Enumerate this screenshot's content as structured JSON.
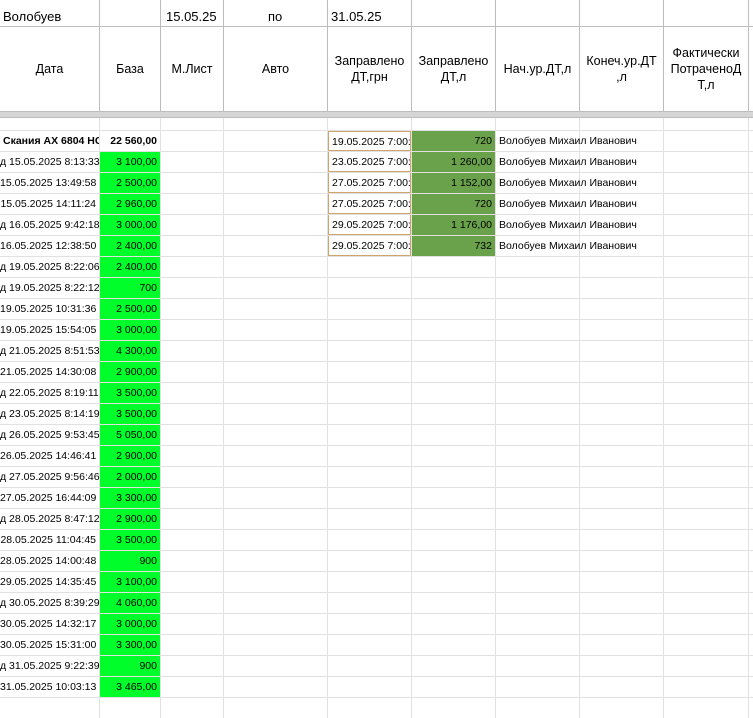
{
  "top": {
    "name": "Волобуев",
    "date_from": "15.05.25",
    "to_label": "по",
    "date_to": "31.05.25"
  },
  "headers": {
    "date": "Дата",
    "base": "База",
    "m_list": "М.Лист",
    "auto": "Авто",
    "fueled_uah": "Заправлено ДТ,грн",
    "fueled_l": "Заправлено ДТ,л",
    "start_level": "Нач.ур.ДТ,л",
    "end_level": "Конеч.ур.ДТ ,л",
    "actual_used": "Фактически ПотраченоД Т,л"
  },
  "summary": {
    "vehicle": "Скания АХ 6804 НС",
    "total": "22 560,00"
  },
  "base_rows": [
    {
      "date": "д 15.05.2025 8:13:33",
      "amount": "3 100,00"
    },
    {
      "date": "15.05.2025 13:49:58",
      "amount": "2 500,00"
    },
    {
      "date": "15.05.2025 14:11:24",
      "amount": "2 960,00"
    },
    {
      "date": "д 16.05.2025 9:42:18",
      "amount": "3 000,00"
    },
    {
      "date": "16.05.2025 12:38:50",
      "amount": "2 400,00"
    },
    {
      "date": "д 19.05.2025 8:22:06",
      "amount": "2 400,00"
    },
    {
      "date": "д 19.05.2025 8:22:12",
      "amount": "700"
    },
    {
      "date": "19.05.2025 10:31:36",
      "amount": "2 500,00"
    },
    {
      "date": "19.05.2025 15:54:05",
      "amount": "3 000,00"
    },
    {
      "date": "д 21.05.2025 8:51:53",
      "amount": "4 300,00"
    },
    {
      "date": "21.05.2025 14:30:08",
      "amount": "2 900,00"
    },
    {
      "date": "д 22.05.2025 8:19:11",
      "amount": "3 500,00"
    },
    {
      "date": "д 23.05.2025 8:14:19",
      "amount": "3 500,00"
    },
    {
      "date": "д 26.05.2025 9:53:45",
      "amount": "5 050,00"
    },
    {
      "date": "26.05.2025 14:46:41",
      "amount": "2 900,00"
    },
    {
      "date": "д 27.05.2025 9:56:46",
      "amount": "2 000,00"
    },
    {
      "date": "27.05.2025 16:44:09",
      "amount": "3 300,00"
    },
    {
      "date": "д 28.05.2025 8:47:12",
      "amount": "2 900,00"
    },
    {
      "date": "28.05.2025 11:04:45",
      "amount": "3 500,00"
    },
    {
      "date": "28.05.2025 14:00:48",
      "amount": "900"
    },
    {
      "date": "29.05.2025 14:35:45",
      "amount": "3 100,00"
    },
    {
      "date": "д 30.05.2025 8:39:29",
      "amount": "4 060,00"
    },
    {
      "date": "30.05.2025 14:32:17",
      "amount": "3 000,00"
    },
    {
      "date": "30.05.2025 15:31:00",
      "amount": "3 300,00"
    },
    {
      "date": "д 31.05.2025 9:22:39",
      "amount": "900"
    },
    {
      "date": "31.05.2025 10:03:13",
      "amount": "3 465,00"
    }
  ],
  "fuel_rows": [
    {
      "date": "19.05.2025 7:00:00",
      "liters": "720",
      "driver": "Волобуев Михаил Иванович"
    },
    {
      "date": "23.05.2025 7:00:00",
      "liters": "1 260,00",
      "driver": "Волобуев Михаил Иванович"
    },
    {
      "date": "27.05.2025 7:00:00",
      "liters": "1 152,00",
      "driver": "Волобуев Михаил Иванович"
    },
    {
      "date": "27.05.2025 7:00:00",
      "liters": "720",
      "driver": "Волобуев Михаил Иванович"
    },
    {
      "date": "29.05.2025 7:00:00",
      "liters": "1 176,00",
      "driver": "Волобуев Михаил Иванович"
    },
    {
      "date": "29.05.2025 7:00:00",
      "liters": "732",
      "driver": "Волобуев Михаил Иванович"
    }
  ],
  "colors": {
    "base_fill": "#00ff2a",
    "liters_fill": "#6aa14b",
    "fuel_border": "#cfa56b"
  }
}
